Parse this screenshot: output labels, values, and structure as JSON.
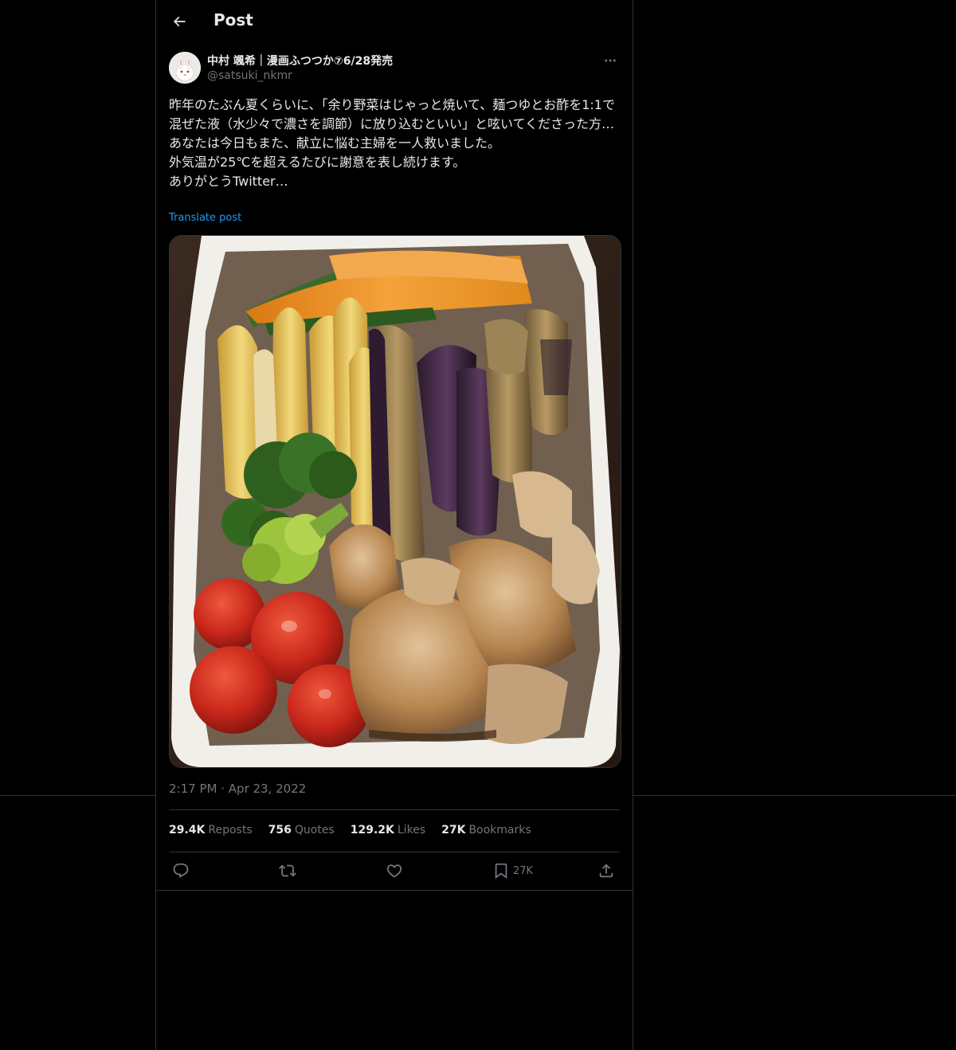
{
  "header": {
    "title": "Post"
  },
  "author": {
    "display_name": "中村 颯希｜漫画ふつつか⑦6/28発売",
    "handle": "@satsuki_nkmr"
  },
  "post": {
    "text": "昨年のたぶん夏くらいに、「余り野菜はじゃっと焼いて、麺つゆとお酢を1:1で混ぜた液（水少々で濃さを調節）に放り込むといい」と呟いてくださった方…\nあなたは今日もまた、献立に悩む主婦を一人救いました。\n外気温が25℃を超えるたびに謝意を表し続けます。\nありがとうTwitter…",
    "translate_label": "Translate post",
    "time": "2:17 PM",
    "date": "Apr 23, 2022"
  },
  "stats": [
    {
      "count": "29.4K",
      "label": "Reposts"
    },
    {
      "count": "756",
      "label": "Quotes"
    },
    {
      "count": "129.2K",
      "label": "Likes"
    },
    {
      "count": "27K",
      "label": "Bookmarks"
    }
  ],
  "actions": {
    "bookmark_count": "27K"
  },
  "icons": {
    "back": "arrow-left-icon",
    "more": "more-horizontal-icon",
    "reply": "reply-icon",
    "repost": "repost-icon",
    "like": "heart-icon",
    "bookmark": "bookmark-icon",
    "share": "share-icon"
  },
  "colors": {
    "background": "#000000",
    "text": "#e7e9ea",
    "secondary": "#71767b",
    "link": "#1d9bf0",
    "border": "#2f3336"
  }
}
